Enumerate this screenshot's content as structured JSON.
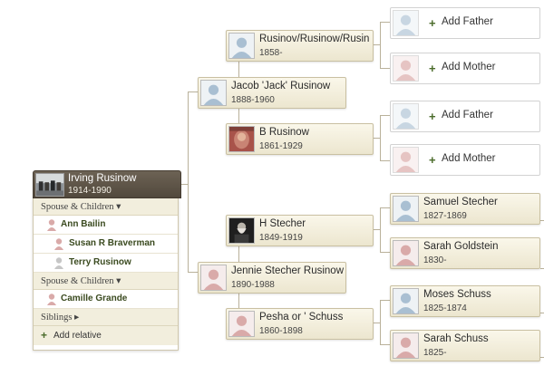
{
  "focus": {
    "name": "Irving Rusinow",
    "years": "1914-1990"
  },
  "panel": {
    "sections": [
      {
        "header": "Spouse & Children ▾",
        "people": [
          {
            "name": "Ann Bailin",
            "gender": "female"
          },
          {
            "name": "Susan R Braverman",
            "gender": "female"
          },
          {
            "name": "Terry Rusinow",
            "gender": "unknown"
          }
        ]
      },
      {
        "header": "Spouse & Children ▾",
        "people": [
          {
            "name": "Camille Grande",
            "gender": "female"
          }
        ]
      },
      {
        "header": "Siblings ▸",
        "people": []
      }
    ],
    "add_relative": "Add relative"
  },
  "parents": {
    "father": {
      "name": "Jacob 'Jack' Rusinow",
      "years": "1888-1960"
    },
    "mother": {
      "name": "Jennie Stecher Rusinow",
      "years": "1890-1988"
    }
  },
  "grandparents": {
    "paternal_father": {
      "name": "Rusinov/Rusinow/Rusin",
      "years": "1858-"
    },
    "paternal_mother": {
      "name": "B Rusinow",
      "years": "1861-1929"
    },
    "maternal_father": {
      "name": "H Stecher",
      "years": "1849-1919"
    },
    "maternal_mother": {
      "name": "Pesha or ' Schuss",
      "years": "1860-1898"
    }
  },
  "great_grandparents": {
    "add_father_label": "Add Father",
    "add_mother_label": "Add Mother",
    "samuel": {
      "name": "Samuel Stecher",
      "years": "1827-1869"
    },
    "sarah_g": {
      "name": "Sarah Goldstein",
      "years": "1830-"
    },
    "moses": {
      "name": "Moses Schuss",
      "years": "1825-1874"
    },
    "sarah_s": {
      "name": "Sarah Schuss",
      "years": "1825-"
    }
  },
  "colors": {
    "male_silhouette": "#a9bfd2",
    "female_silhouette": "#d9aaa9",
    "accent_green": "#4a6b2a"
  }
}
